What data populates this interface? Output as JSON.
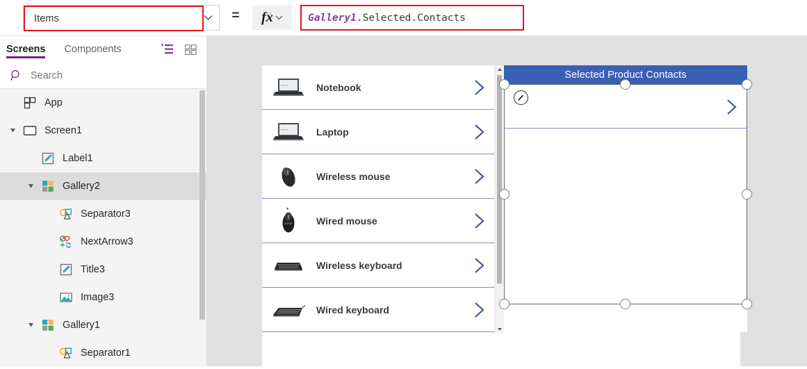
{
  "formula_bar": {
    "property_value": "Items",
    "property_chevron_icon": "chevron-down-icon",
    "equals": "=",
    "fx_glyph": "fx",
    "fx_chevron_icon": "chevron-down-icon",
    "formula_ident": "Gallery1",
    "formula_rest": ".Selected.Contacts",
    "highlight_color": "#e81123",
    "ident_color": "#8a3fa0"
  },
  "sidebar": {
    "tabs": [
      {
        "label": "Screens",
        "active": true
      },
      {
        "label": "Components",
        "active": false
      }
    ],
    "accent_color": "#742774",
    "view_icons": [
      {
        "name": "tree-view-icon"
      },
      {
        "name": "grid-view-icon"
      }
    ],
    "search": {
      "icon": "search-icon",
      "placeholder": "Search",
      "value": ""
    },
    "tree": [
      {
        "label": "App",
        "icon": "app-icon",
        "indent": 0,
        "twisty": "none",
        "selected": false
      },
      {
        "label": "Screen1",
        "icon": "screen-icon",
        "indent": 0,
        "twisty": "expanded",
        "selected": false
      },
      {
        "label": "Label1",
        "icon": "label-icon",
        "indent": 1,
        "twisty": "none",
        "selected": false
      },
      {
        "label": "Gallery2",
        "icon": "gallery-icon",
        "indent": 1,
        "twisty": "expanded",
        "selected": true
      },
      {
        "label": "Separator3",
        "icon": "separator-icon",
        "indent": 2,
        "twisty": "none",
        "selected": false
      },
      {
        "label": "NextArrow3",
        "icon": "nextarrow-icon",
        "indent": 2,
        "twisty": "none",
        "selected": false
      },
      {
        "label": "Title3",
        "icon": "label-icon",
        "indent": 2,
        "twisty": "none",
        "selected": false
      },
      {
        "label": "Image3",
        "icon": "image-icon",
        "indent": 2,
        "twisty": "none",
        "selected": false
      },
      {
        "label": "Gallery1",
        "icon": "gallery-icon",
        "indent": 1,
        "twisty": "expanded",
        "selected": false
      },
      {
        "label": "Separator1",
        "icon": "separator-icon",
        "indent": 2,
        "twisty": "none",
        "selected": false
      }
    ]
  },
  "canvas": {
    "product_gallery": {
      "items": [
        {
          "name": "Notebook",
          "thumb": "laptop-thumb",
          "selected": true
        },
        {
          "name": "Laptop",
          "thumb": "laptop-open-thumb",
          "selected": false
        },
        {
          "name": "Wireless mouse",
          "thumb": "wireless-mouse-thumb",
          "selected": false
        },
        {
          "name": "Wired mouse",
          "thumb": "wired-mouse-thumb",
          "selected": false
        },
        {
          "name": "Wireless keyboard",
          "thumb": "wireless-keyboard-thumb",
          "selected": false
        },
        {
          "name": "Wired keyboard",
          "thumb": "wired-keyboard-thumb",
          "selected": false
        }
      ],
      "chevron_icon": "chevron-right-icon",
      "separator_color": "#8490c8"
    },
    "contacts_gallery": {
      "header_title": "Selected Product Contacts",
      "header_bg": "#3a60b5",
      "header_fg": "#ffffff",
      "chevron_icon": "chevron-right-icon",
      "edit_badge_icon": "pencil-icon",
      "selected": true
    }
  }
}
